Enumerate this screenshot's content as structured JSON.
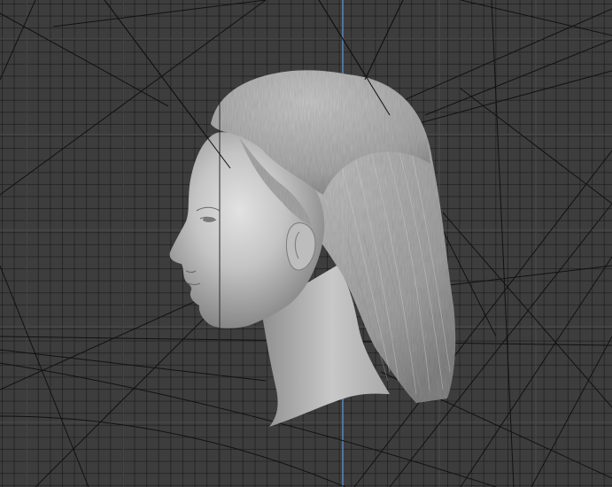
{
  "viewport": {
    "background_color": "#3d3d3d",
    "grid_minor_color": "#2d2d2d",
    "grid_major_color": "#4a4a4a",
    "y_axis_color": "#5a7fb5",
    "guide_line_color": "#111111"
  },
  "model": {
    "name": "head-with-hair",
    "skin_color": "#bdbdbd",
    "hair_color": "#b8b8b8"
  }
}
